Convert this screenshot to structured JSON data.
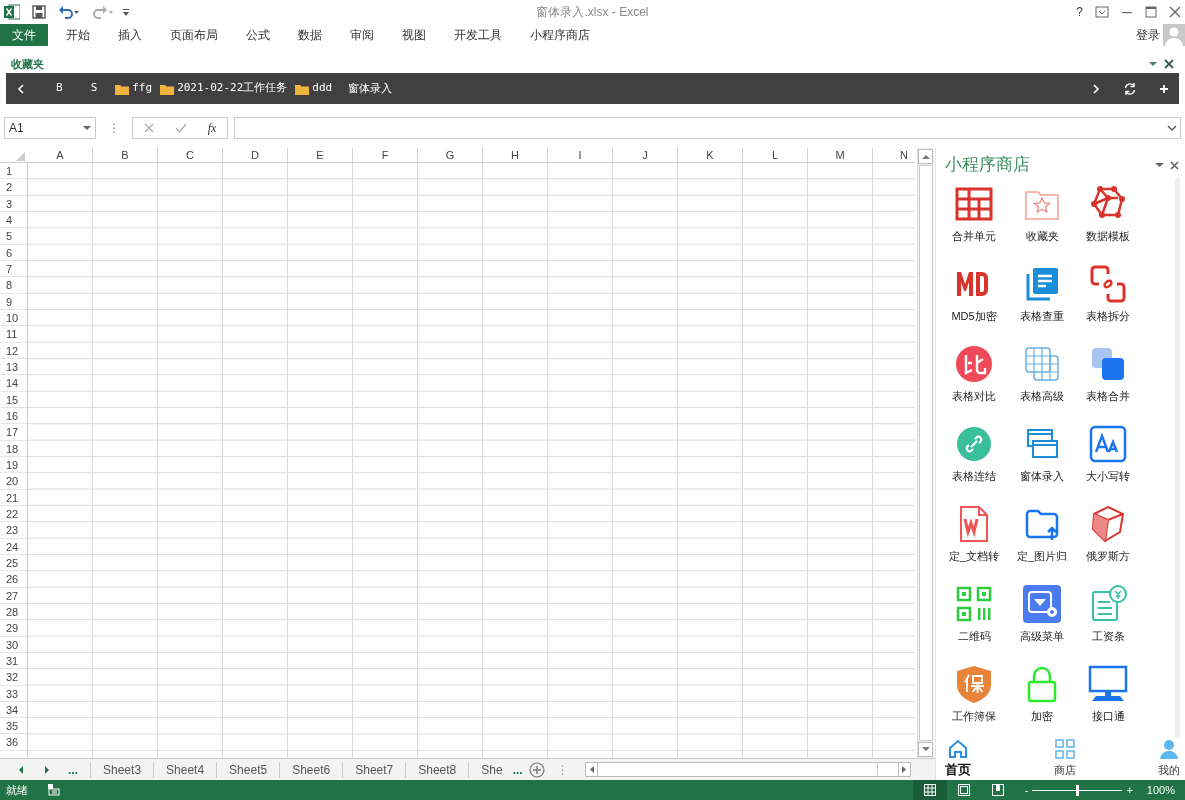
{
  "title_bar": {
    "title": "窗体录入.xlsx - Excel",
    "help": "?",
    "login": "登录"
  },
  "ribbon_tabs": [
    {
      "label": "文件",
      "kind": "file"
    },
    {
      "label": "开始",
      "kind": "tab"
    },
    {
      "label": "插入",
      "kind": "tab"
    },
    {
      "label": "页面布局",
      "kind": "tab"
    },
    {
      "label": "公式",
      "kind": "tab"
    },
    {
      "label": "数据",
      "kind": "tab"
    },
    {
      "label": "审阅",
      "kind": "tab"
    },
    {
      "label": "视图",
      "kind": "tab"
    },
    {
      "label": "开发工具",
      "kind": "tab"
    },
    {
      "label": "小程序商店",
      "kind": "tab"
    }
  ],
  "favorites": {
    "title": "收藏夹",
    "items": [
      {
        "label": "B",
        "kind": "letter"
      },
      {
        "label": "S",
        "kind": "letter"
      },
      {
        "label": "ffg",
        "kind": "folder"
      },
      {
        "label": "2021-02-22工作任务",
        "kind": "folder"
      },
      {
        "label": "ddd",
        "kind": "folder"
      },
      {
        "label": "窗体录入",
        "kind": "file"
      }
    ]
  },
  "formula_bar": {
    "name_box": "A1",
    "fx": "fx",
    "more": "⋮"
  },
  "sheet": {
    "columns": [
      "A",
      "B",
      "C",
      "D",
      "E",
      "F",
      "G",
      "H",
      "I",
      "J",
      "K",
      "L",
      "M",
      "N"
    ],
    "rows": [
      "1",
      "2",
      "3",
      "4",
      "5",
      "6",
      "7",
      "8",
      "9",
      "10",
      "11",
      "12",
      "13",
      "14",
      "15",
      "16",
      "17",
      "18",
      "19",
      "20",
      "21",
      "22",
      "23",
      "24",
      "25",
      "26",
      "27",
      "28",
      "29",
      "30",
      "31",
      "32",
      "33",
      "34",
      "35",
      "36"
    ]
  },
  "sheet_tabs": {
    "more_left": "...",
    "items": [
      {
        "label": "Sheet3"
      },
      {
        "label": "Sheet4"
      },
      {
        "label": "Sheet5"
      },
      {
        "label": "Sheet6"
      },
      {
        "label": "Sheet7"
      },
      {
        "label": "Sheet8"
      },
      {
        "label": "She"
      }
    ],
    "more_right": "...",
    "split": "⋮"
  },
  "store": {
    "title": "小程序商店",
    "apps": [
      {
        "label": "合并单元"
      },
      {
        "label": "收藏夹"
      },
      {
        "label": "数据模板"
      },
      {
        "label": "MD5加密"
      },
      {
        "label": "表格查重"
      },
      {
        "label": "表格拆分"
      },
      {
        "label": "表格对比"
      },
      {
        "label": "表格高级"
      },
      {
        "label": "表格合并"
      },
      {
        "label": "表格连结"
      },
      {
        "label": "窗体录入"
      },
      {
        "label": "大小写转"
      },
      {
        "label": "定_文档转"
      },
      {
        "label": "定_图片归"
      },
      {
        "label": "俄罗斯方"
      },
      {
        "label": "二维码"
      },
      {
        "label": "高级菜单"
      },
      {
        "label": "工资条"
      },
      {
        "label": "工作簿保"
      },
      {
        "label": "加密"
      },
      {
        "label": "接口通"
      }
    ],
    "nav": [
      {
        "label": "首页",
        "selected": true
      },
      {
        "label": "商店",
        "selected": false
      },
      {
        "label": "我的",
        "selected": false
      }
    ]
  },
  "status_bar": {
    "status": "就绪",
    "views": [
      {
        "kind": "normal",
        "selected": true
      },
      {
        "kind": "page_layout",
        "selected": false
      },
      {
        "kind": "page_break",
        "selected": false
      }
    ],
    "zoom": {
      "minus": "-",
      "plus": "+",
      "level": 0.5,
      "reading": "100%"
    }
  }
}
